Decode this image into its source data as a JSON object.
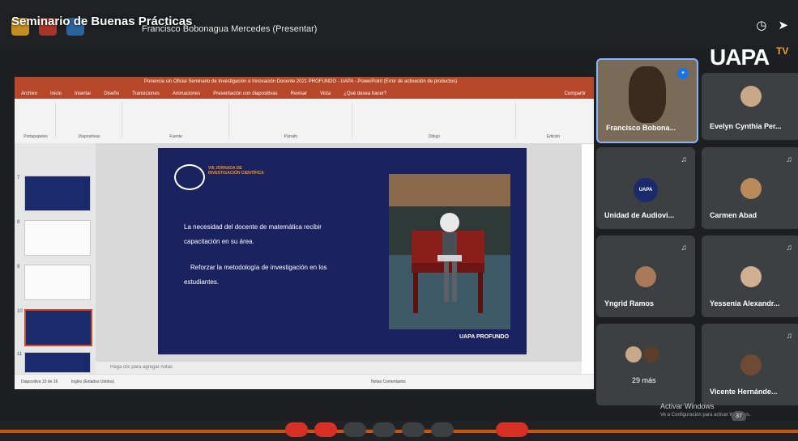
{
  "meeting": {
    "title": "Seminario de Buenas Prácticas",
    "presenter": "Francisco Bobonagua Mercedes (Presentar)"
  },
  "ppt": {
    "window_title": "Ponencia sin Oficial Seminario de Investigación e Innovación Docente 2021 PROFUNDO - UAPA - PowerPoint (Error de activación de productos)",
    "menu": [
      "Archivo",
      "Inicio",
      "Insertar",
      "Diseño",
      "Transiciones",
      "Animaciones",
      "Presentación con diapositivas",
      "Revisar",
      "Vista",
      "¿Qué desea hacer?",
      "Compartir"
    ],
    "ribbon_groups": [
      "Portapapeles",
      "Diapositivas",
      "Fuente",
      "Párrafo",
      "Dibujo",
      "Edición"
    ],
    "thumb_numbers": [
      "7",
      "8",
      "9",
      "10",
      "11"
    ],
    "notes_placeholder": "Haga clic para agregar notas",
    "status_left": "Diapositiva 10 de 16",
    "status_lang": "Inglés (Estados Unidos)",
    "status_right": "Notas   Comentarios"
  },
  "slide": {
    "header": "VIII JORNADA DE INVESTIGACIÓN CIENTÍFICA",
    "line1": "La necesidad del docente de matemática recibir",
    "line2": "capacitación en su área.",
    "line3": "Reforzar la metodología de investigación en los",
    "line4": "estudiantes.",
    "footer": "UAPA PROFUNDO"
  },
  "brand": {
    "name": "UAPA",
    "tv": "TV"
  },
  "participants": [
    {
      "name": "Francisco Bobona...",
      "speaking": true
    },
    {
      "name": "Evelyn Cynthia Per..."
    },
    {
      "name": "Unidad de Audiovi...",
      "avatar_text": "UAPA"
    },
    {
      "name": "Carmen Abad"
    },
    {
      "name": "Yngrid Ramos"
    },
    {
      "name": "Yessenia Alexandr..."
    },
    {
      "name": "29 más"
    },
    {
      "name": "Vicente Hernánde..."
    }
  ],
  "watermark": {
    "line1": "Activar Windows",
    "line2": "Ve a Configuración para activar Windows."
  },
  "badge_count": "37",
  "icons": [
    "timer-icon",
    "share-arrow-icon",
    "mic-muted-icon",
    "hand-icon"
  ]
}
